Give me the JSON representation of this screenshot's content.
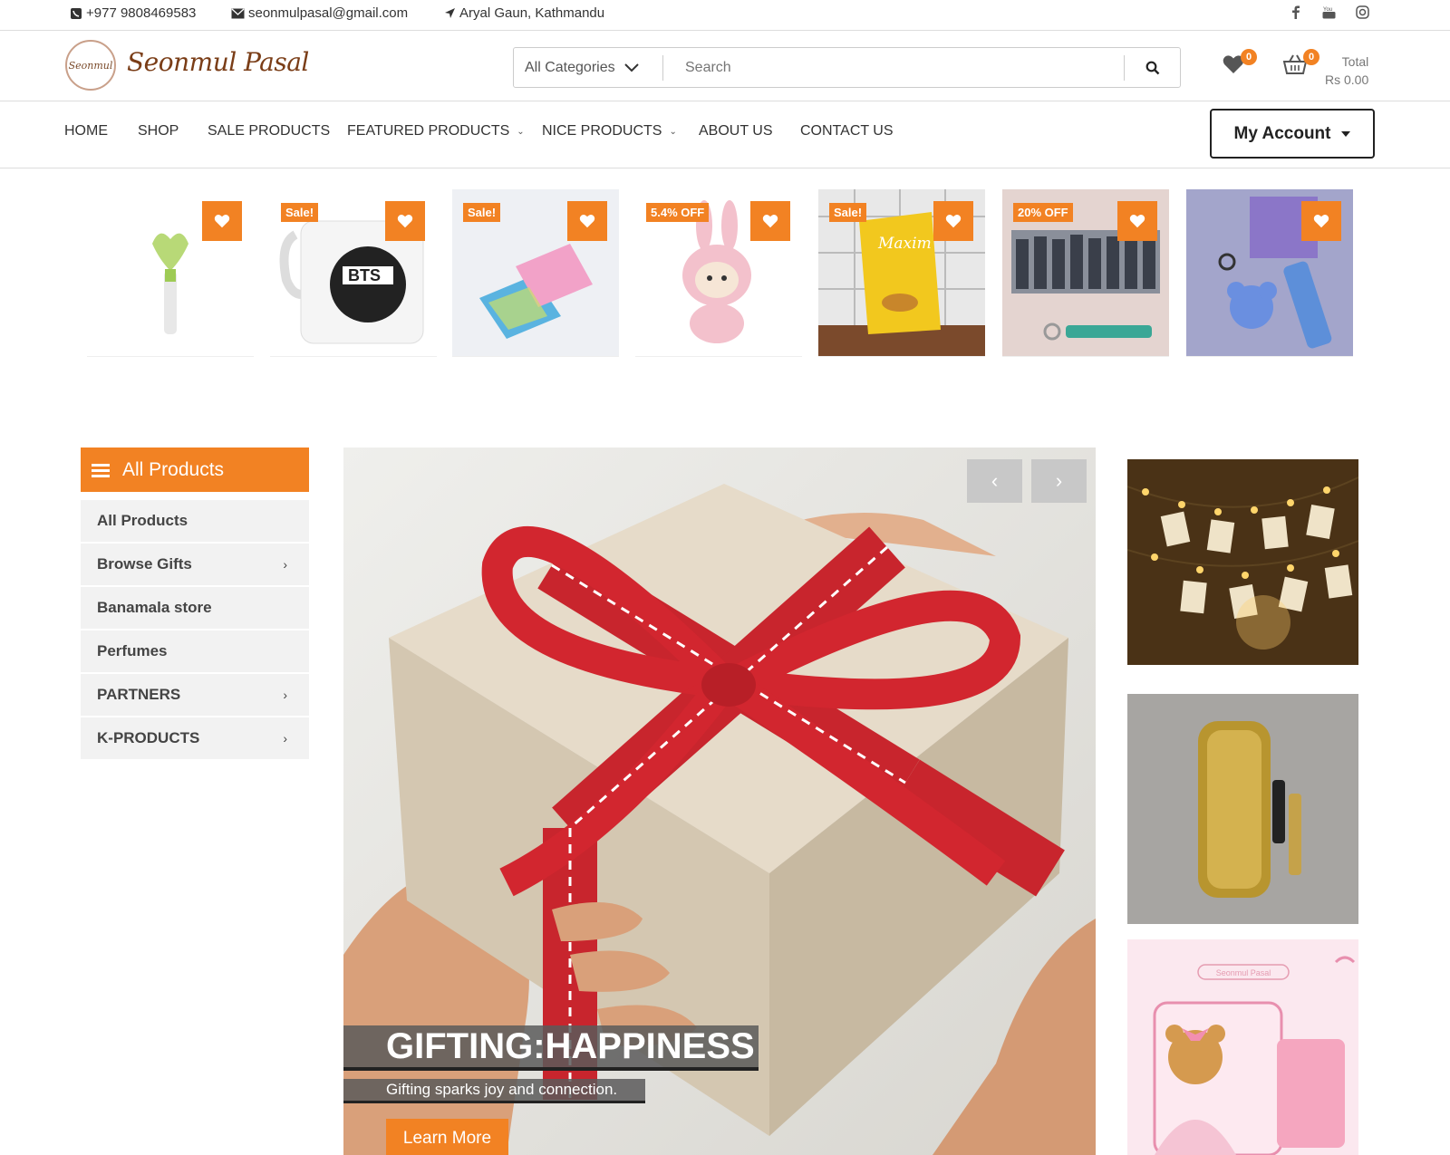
{
  "topbar": {
    "phone": "+977 9808469583",
    "email": "seonmulpasal@gmail.com",
    "location": "Aryal Gaun, Kathmandu",
    "social": [
      "facebook-icon",
      "youtube-icon",
      "instagram-icon"
    ]
  },
  "header": {
    "logo_small": "Seonmul",
    "logo_text": "Seonmul Pasal",
    "category_select": "All Categories",
    "search_placeholder": "Search",
    "wishlist_count": "0",
    "cart_count": "0",
    "total_label": "Total",
    "total_value": "Rs 0.00"
  },
  "nav": {
    "links": [
      {
        "label": "HOME"
      },
      {
        "label": "SHOP"
      },
      {
        "label": "SALE PRODUCTS"
      },
      {
        "label": "FEATURED PRODUCTS"
      },
      {
        "label": "NICE PRODUCTS"
      },
      {
        "label": "ABOUT US"
      },
      {
        "label": "CONTACT US"
      }
    ],
    "account": "My Account"
  },
  "products": [
    {
      "tag": "",
      "image": "light-stick"
    },
    {
      "tag": "Sale!",
      "image": "bts-mug"
    },
    {
      "tag": "Sale!",
      "image": "stationery-cards"
    },
    {
      "tag": "5.4% OFF",
      "image": "pink-bunny-plush"
    },
    {
      "tag": "Sale!",
      "image": "maxim-coffee-box"
    },
    {
      "tag": "20% OFF",
      "image": "photo-keychain"
    },
    {
      "tag": "",
      "image": "bear-keychain"
    }
  ],
  "sidebar": {
    "title": "All Products",
    "items": [
      {
        "label": "All Products",
        "arrow": ""
      },
      {
        "label": "Browse Gifts",
        "arrow": "›"
      },
      {
        "label": "Banamala store",
        "arrow": ""
      },
      {
        "label": "Perfumes",
        "arrow": ""
      },
      {
        "label": "PARTNERS",
        "arrow": "›"
      },
      {
        "label": "K-PRODUCTS",
        "arrow": "›"
      }
    ]
  },
  "hero": {
    "title": "GIFTING:HAPPINESS",
    "subtitle": "Gifting sparks joy and connection.",
    "cta": "Learn More",
    "prev": "‹",
    "next": "›"
  },
  "promos": {
    "third_brand": "Seonmul Pasal"
  },
  "colors": {
    "accent": "#f28223"
  }
}
